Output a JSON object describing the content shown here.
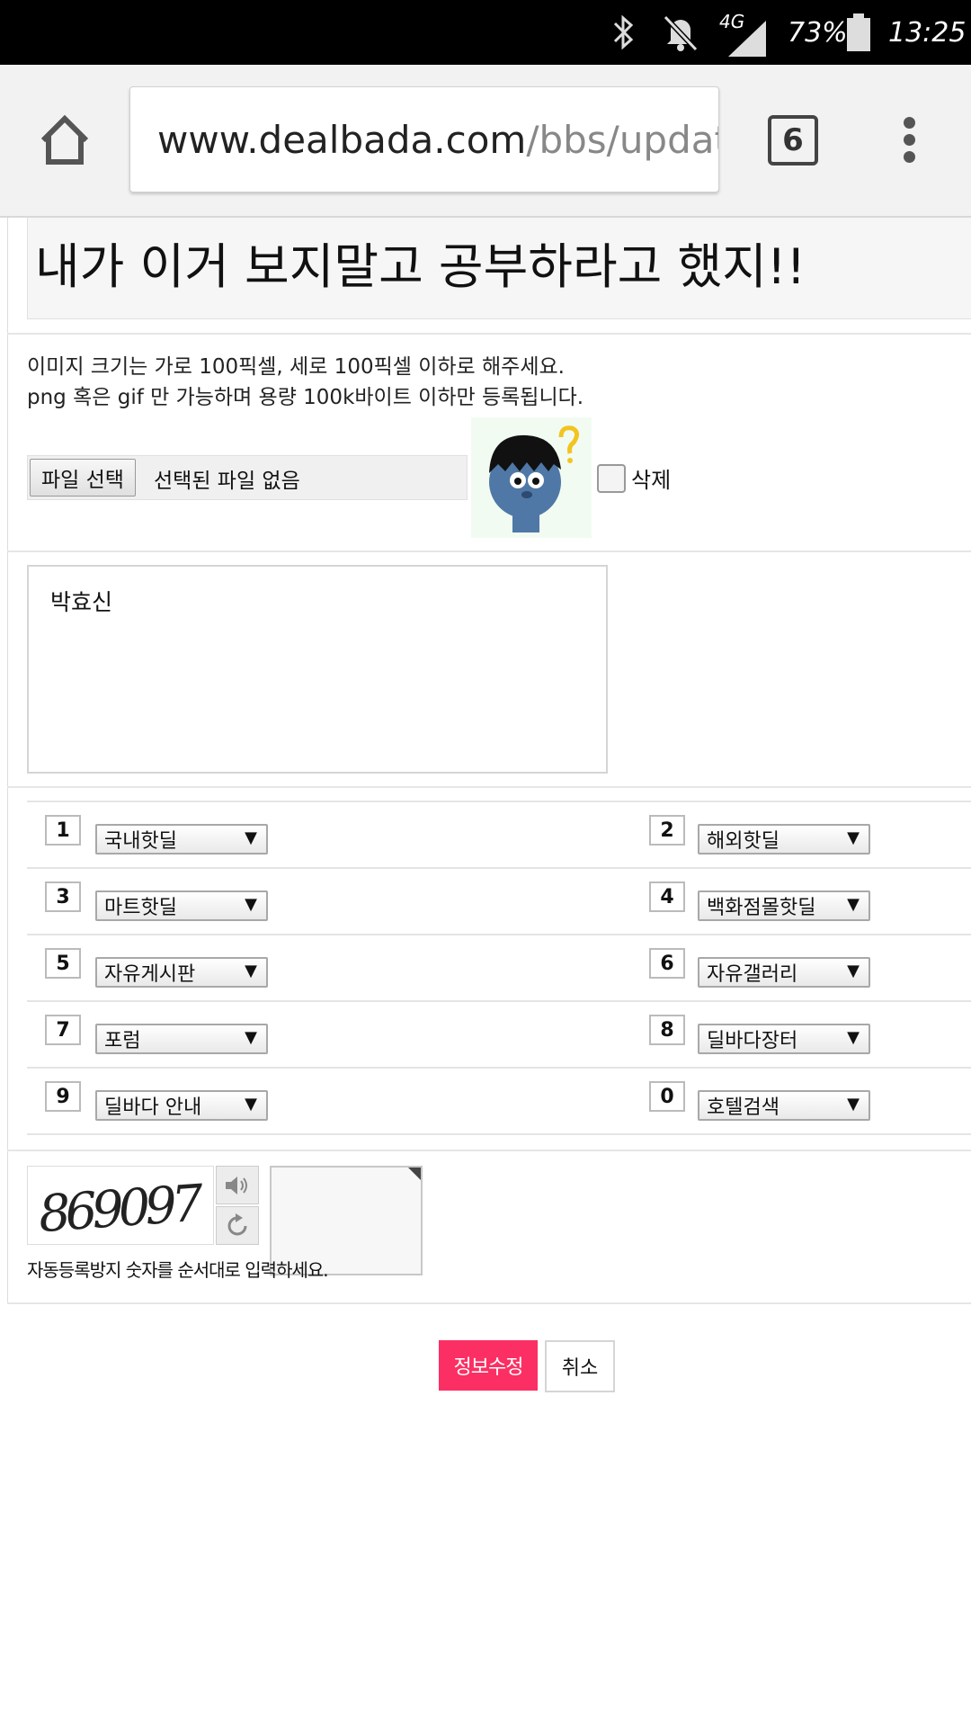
{
  "status_bar": {
    "network": "4G",
    "battery": "73%",
    "time": "13:25"
  },
  "browser": {
    "url_host": "www.dealbada.com",
    "url_path": "/bbs/updat",
    "tab_count": "6"
  },
  "page": {
    "title": "내가 이거 보지말고 공부하라고 했지!!",
    "notice_line1": "이미지 크기는 가로 100픽셀, 세로 100픽셀 이하로 해주세요.",
    "notice_line2": "png 혹은 gif 만 가능하며 용량 100k바이트 이하만 등록됩니다.",
    "file_button": "파일 선택",
    "file_status": "선택된 파일 없음",
    "delete_label": "삭제",
    "signature_text": "박효신",
    "quick_links": [
      {
        "key": "1",
        "value": "국내핫딜"
      },
      {
        "key": "2",
        "value": "해외핫딜"
      },
      {
        "key": "3",
        "value": "마트핫딜"
      },
      {
        "key": "4",
        "value": "백화점몰핫딜"
      },
      {
        "key": "5",
        "value": "자유게시판"
      },
      {
        "key": "6",
        "value": "자유갤러리"
      },
      {
        "key": "7",
        "value": "포럼"
      },
      {
        "key": "8",
        "value": "딜바다장터"
      },
      {
        "key": "9",
        "value": "딜바다 안내"
      },
      {
        "key": "0",
        "value": "호텔검색"
      }
    ],
    "captcha_code": "869097",
    "captcha_hint": "자동등록방지 숫자를 순서대로 입력하세요.",
    "submit_label": "정보수정",
    "cancel_label": "취소"
  },
  "colors": {
    "accent": "#fb2f63",
    "status_bar_bg": "#000000",
    "toolbar_bg": "#f2f2f2"
  }
}
